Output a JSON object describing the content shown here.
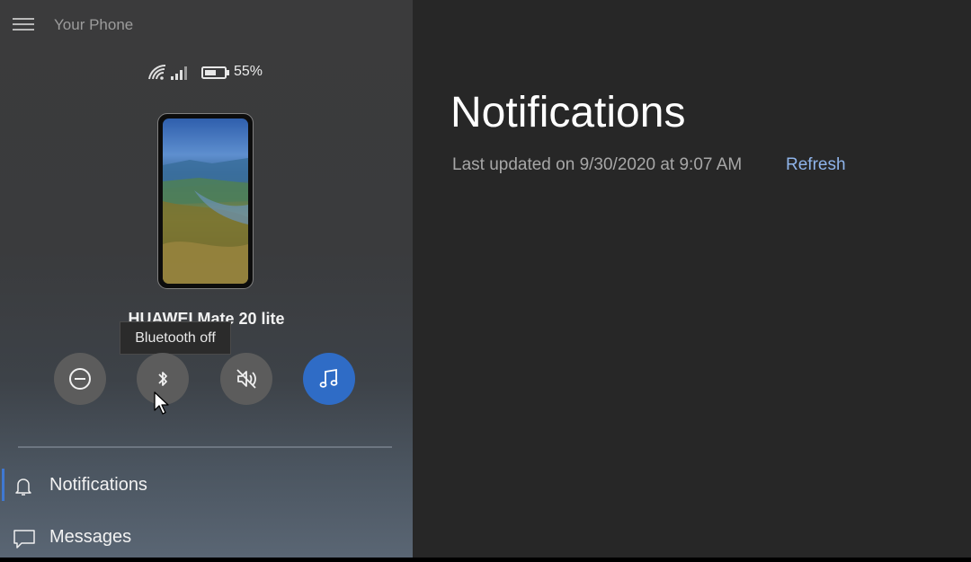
{
  "app": {
    "title": "Your Phone"
  },
  "status": {
    "battery_percent": "55%"
  },
  "device": {
    "name": "HUAWEI Mate 20 lite"
  },
  "tooltip": {
    "text": "Bluetooth off"
  },
  "quick_actions": [
    {
      "name": "do-not-disturb",
      "icon": "minus-circle-icon",
      "active": false
    },
    {
      "name": "bluetooth",
      "icon": "bluetooth-icon",
      "active": false
    },
    {
      "name": "mute",
      "icon": "speaker-muted-icon",
      "active": false
    },
    {
      "name": "media",
      "icon": "music-note-icon",
      "active": true
    }
  ],
  "nav": {
    "items": [
      {
        "label": "Notifications",
        "icon": "bell-icon",
        "selected": true
      },
      {
        "label": "Messages",
        "icon": "message-icon",
        "selected": false
      }
    ]
  },
  "main": {
    "title": "Notifications",
    "last_updated": "Last updated on 9/30/2020 at 9:07 AM",
    "refresh_label": "Refresh"
  },
  "colors": {
    "accent": "#2f6cc6",
    "link": "#8fb4ea",
    "content_background": "#272727"
  }
}
